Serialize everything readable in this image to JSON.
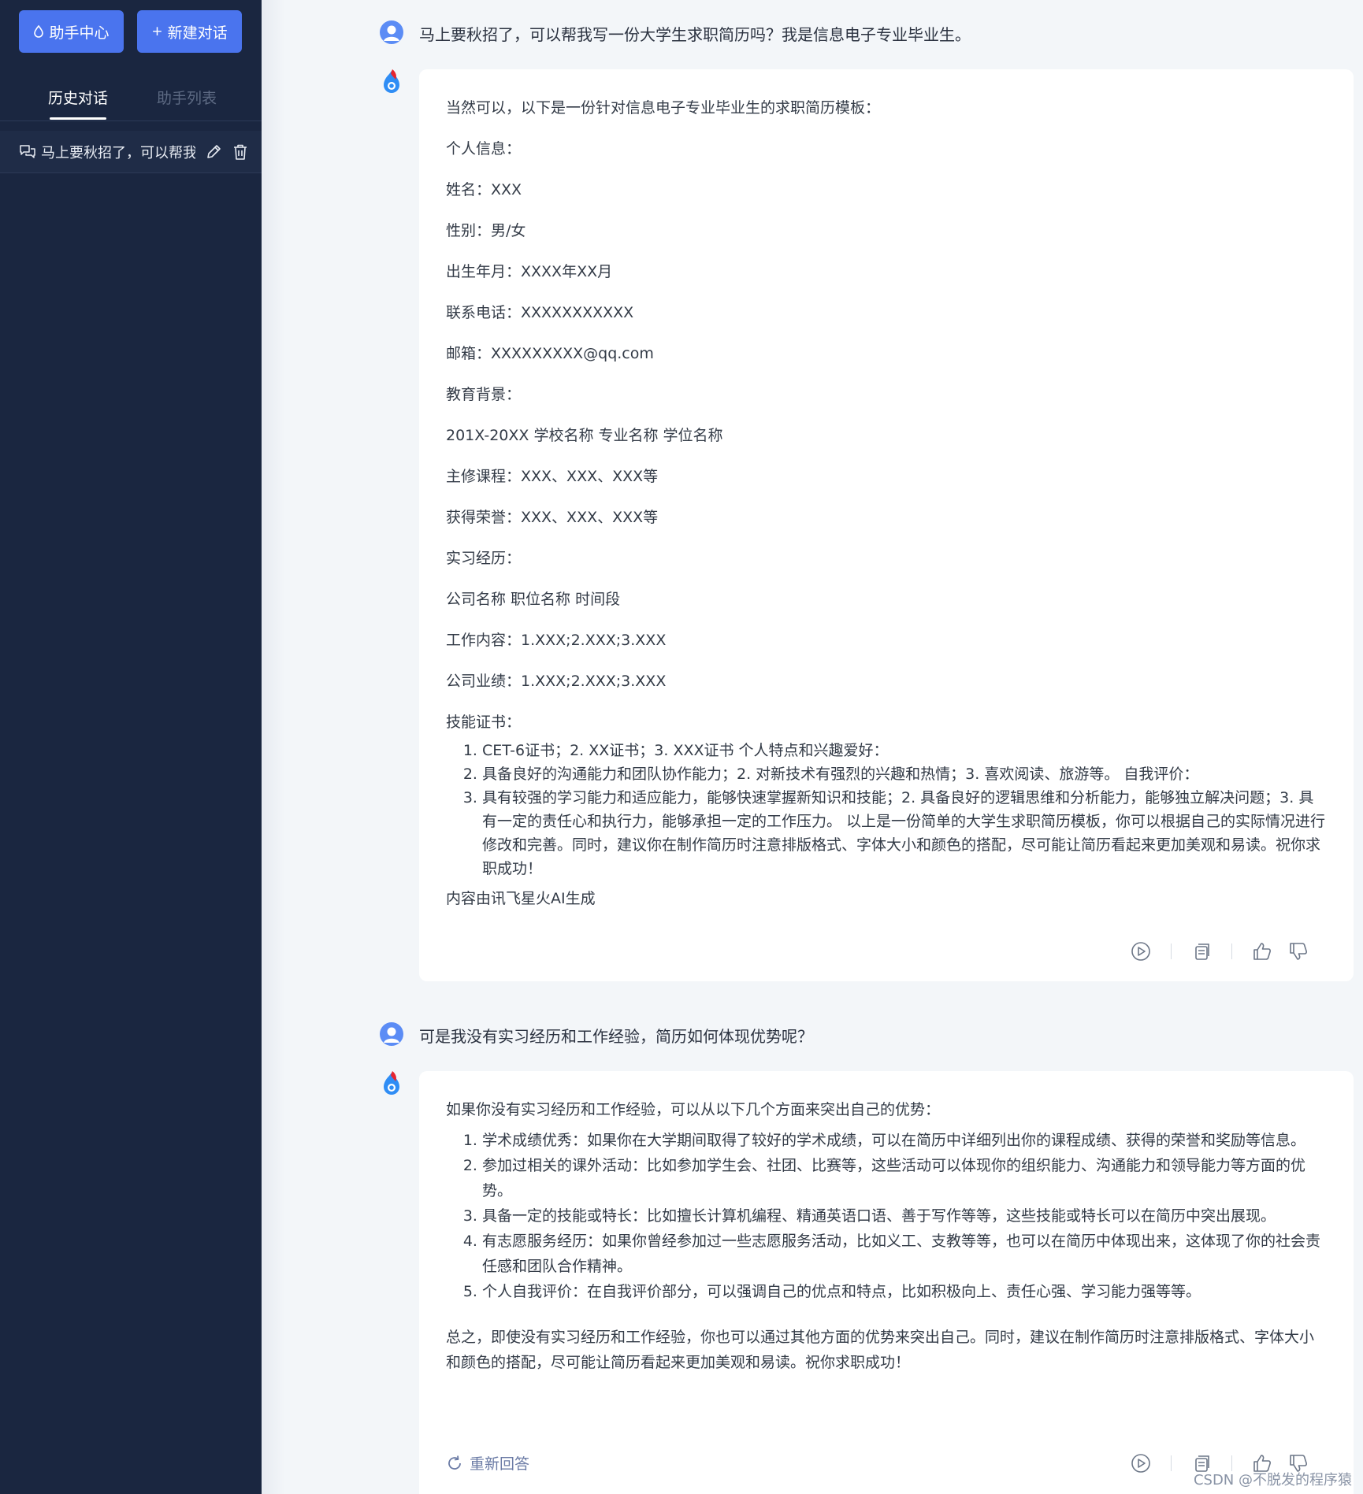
{
  "sidebar": {
    "help_center": "助手中心",
    "new_chat_icon": "+",
    "new_chat": "新建对话",
    "tabs": {
      "history": "历史对话",
      "assistants": "助手列表"
    },
    "conversations": [
      {
        "title": "马上要秋招了，可以帮我写一份大学生求职简历吗？我是信息电子专业毕业生。"
      }
    ]
  },
  "chat": {
    "q1": "马上要秋招了，可以帮我写一份大学生求职简历吗？我是信息电子专业毕业生。",
    "a1": {
      "lines": [
        "当然可以，以下是一份针对信息电子专业毕业生的求职简历模板：",
        "个人信息：",
        "姓名：XXX",
        "性别：男/女",
        "出生年月：XXXX年XX月",
        "联系电话：XXXXXXXXXXX",
        "邮箱：XXXXXXXXX@qq.com",
        "教育背景：",
        "201X-20XX 学校名称 专业名称 学位名称",
        "主修课程：XXX、XXX、XXX等",
        "获得荣誉：XXX、XXX、XXX等",
        "实习经历：",
        "公司名称 职位名称 时间段",
        "工作内容：1.XXX;2.XXX;3.XXX",
        "公司业绩：1.XXX;2.XXX;3.XXX",
        "技能证书："
      ],
      "list": [
        "CET-6证书；2. XX证书；3. XXX证书 个人特点和兴趣爱好：",
        "具备良好的沟通能力和团队协作能力；2. 对新技术有强烈的兴趣和热情；3. 喜欢阅读、旅游等。 自我评价：",
        "具有较强的学习能力和适应能力，能够快速掌握新知识和技能；2. 具备良好的逻辑思维和分析能力，能够独立解决问题；3. 具有一定的责任心和执行力，能够承担一定的工作压力。 以上是一份简单的大学生求职简历模板，你可以根据自己的实际情况进行修改和完善。同时，建议你在制作简历时注意排版格式、字体大小和颜色的搭配，尽可能让简历看起来更加美观和易读。祝你求职成功！"
      ],
      "footer": "内容由讯飞星火AI生成"
    },
    "q2": "可是我没有实习经历和工作经验，简历如何体现优势呢？",
    "a2": {
      "intro": "如果你没有实习经历和工作经验，可以从以下几个方面来突出自己的优势：",
      "list": [
        "学术成绩优秀：如果你在大学期间取得了较好的学术成绩，可以在简历中详细列出你的课程成绩、获得的荣誉和奖励等信息。",
        "参加过相关的课外活动：比如参加学生会、社团、比赛等，这些活动可以体现你的组织能力、沟通能力和领导能力等方面的优势。",
        "具备一定的技能或特长：比如擅长计算机编程、精通英语口语、善于写作等等，这些技能或特长可以在简历中突出展现。",
        "有志愿服务经历：如果你曾经参加过一些志愿服务活动，比如义工、支教等等，也可以在简历中体现出来，这体现了你的社会责任感和团队合作精神。",
        "个人自我评价：在自我评价部分，可以强调自己的优点和特点，比如积极向上、责任心强、学习能力强等等。"
      ],
      "summary": "总之，即使没有实习经历和工作经验，你也可以通过其他方面的优势来突出自己。同时，建议在制作简历时注意排版格式、字体大小和颜色的搭配，尽可能让简历看起来更加美观和易读。祝你求职成功！",
      "regenerate": "重新回答"
    },
    "credit": "CSDN @不脱发的程序猿"
  },
  "icons": {
    "help": "droplet-icon",
    "user_avatar": "user-avatar-icon",
    "ai_avatar": "spark-logo-icon",
    "chat": "chat-bubbles-icon",
    "edit": "pencil-icon",
    "delete": "trash-icon",
    "play": "play-circle-icon",
    "copy": "copy-icon",
    "like": "thumbs-up-icon",
    "dislike": "thumbs-down-icon",
    "regenerate": "refresh-icon"
  },
  "colors": {
    "sidebar_bg": "#1a2640",
    "primary": "#4a74ee",
    "card_bg": "#ffffff",
    "main_bg": "#f3f6f9"
  }
}
